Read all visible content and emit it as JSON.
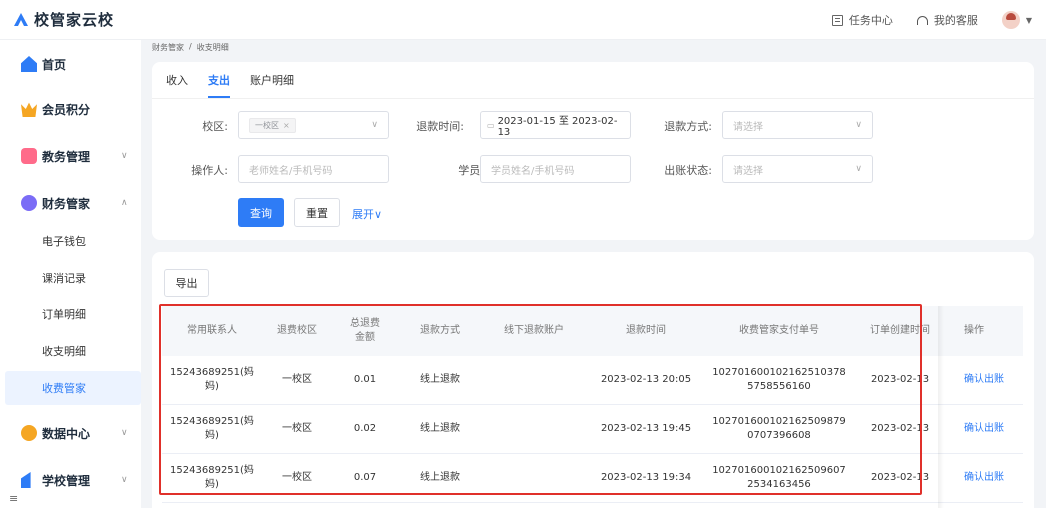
{
  "app": {
    "logo_text": "校管家云校"
  },
  "topbar": {
    "task_center": "任务中心",
    "my_service": "我的客服"
  },
  "sidebar": {
    "items": [
      {
        "label": "首页",
        "color": "#2e7cf6"
      },
      {
        "label": "会员积分",
        "color": "#f5a623"
      },
      {
        "label": "教务管理",
        "color": "#ff6b8a"
      },
      {
        "label": "财务管家",
        "color": "#7b6cf6"
      },
      {
        "label": "数据中心",
        "color": "#f5a623"
      },
      {
        "label": "学校管理",
        "color": "#2e7cf6"
      }
    ],
    "subitems": [
      "电子钱包",
      "课消记录",
      "订单明细",
      "收支明细",
      "收费管家"
    ],
    "fold_icon": "≡"
  },
  "breadcrumb": {
    "parent": "财务管家",
    "separator": "/",
    "current": "收支明细"
  },
  "tabs": [
    "收入",
    "支出",
    "账户明细"
  ],
  "filters": {
    "campus_label": "校区:",
    "campus_tag": "一校区",
    "refund_time_label": "退款时间:",
    "refund_time_value": "2023-01-15 至 2023-02-13",
    "refund_method_label": "退款方式:",
    "refund_method_placeholder": "请选择",
    "operator_label": "操作人:",
    "operator_placeholder": "老师姓名/手机号码",
    "student_label": "学员:",
    "student_placeholder": "学员姓名/手机号码",
    "status_label": "出账状态:",
    "status_placeholder": "请选择"
  },
  "buttons": {
    "query": "查询",
    "reset": "重置",
    "expand": "展开∨",
    "export": "导出"
  },
  "table": {
    "headers": [
      "常用联系人",
      "退费校区",
      "总退费\n金额",
      "退款方式",
      "线下退款账户",
      "退款时间",
      "收费管家支付单号",
      "订单创建时间",
      "操作"
    ],
    "rows": [
      {
        "contact": "15243689251(妈\n妈)",
        "campus": "一校区",
        "amount": "0.01",
        "method": "线上退款",
        "account": "",
        "time": "2023-02-13 20:05",
        "pay_no": "102701600102162510378\n5758556160",
        "created": "2023-02-13",
        "action": "确认出账"
      },
      {
        "contact": "15243689251(妈\n妈)",
        "campus": "一校区",
        "amount": "0.02",
        "method": "线上退款",
        "account": "",
        "time": "2023-02-13 19:45",
        "pay_no": "102701600102162509879\n0707396608",
        "created": "2023-02-13",
        "action": "确认出账"
      },
      {
        "contact": "15243689251(妈\n妈)",
        "campus": "一校区",
        "amount": "0.07",
        "method": "线上退款",
        "account": "",
        "time": "2023-02-13 19:34",
        "pay_no": "102701600102162509607\n2534163456",
        "created": "2023-02-13",
        "action": "确认出账"
      }
    ]
  }
}
